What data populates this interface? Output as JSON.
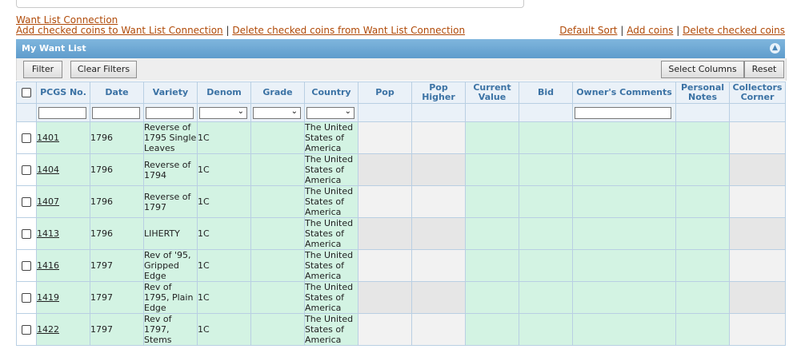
{
  "links": {
    "want_list_connection": "Want List Connection",
    "add_checked": "Add checked coins to Want List Connection",
    "delete_checked": "Delete checked coins from Want List Connection",
    "default_sort": "Default Sort",
    "add_coins": "Add coins",
    "delete_checked_coins": "Delete checked coins",
    "separator": "|"
  },
  "panel": {
    "title": "My Want List"
  },
  "toolbar": {
    "filter": "Filter",
    "clear_filters": "Clear Filters",
    "select_columns": "Select Columns",
    "reset": "Reset"
  },
  "columns": {
    "pcgs_no": "PCGS No.",
    "date": "Date",
    "variety": "Variety",
    "denom": "Denom",
    "grade": "Grade",
    "country": "Country",
    "pop": "Pop",
    "pop_higher": "Pop Higher",
    "current_value": "Current Value",
    "bid": "Bid",
    "owners_comments": "Owner's Comments",
    "personal_notes": "Personal Notes",
    "collectors_corner": "Collectors Corner"
  },
  "rows": [
    {
      "pcgs": "1401",
      "date": "1796",
      "variety": "Reverse of 1795 Single Leaves",
      "denom": "1C",
      "country": "The United States of America"
    },
    {
      "pcgs": "1404",
      "date": "1796",
      "variety": "Reverse of 1794",
      "denom": "1C",
      "country": "The United States of America"
    },
    {
      "pcgs": "1407",
      "date": "1796",
      "variety": "Reverse of 1797",
      "denom": "1C",
      "country": "The United States of America"
    },
    {
      "pcgs": "1413",
      "date": "1796",
      "variety": "LIHERTY",
      "denom": "1C",
      "country": "The United States of America"
    },
    {
      "pcgs": "1416",
      "date": "1797",
      "variety": "Rev of '95, Gripped Edge",
      "denom": "1C",
      "country": "The United States of America"
    },
    {
      "pcgs": "1419",
      "date": "1797",
      "variety": "Rev of 1795, Plain Edge",
      "denom": "1C",
      "country": "The United States of America"
    },
    {
      "pcgs": "1422",
      "date": "1797",
      "variety": "Rev of 1797, Stems",
      "denom": "1C",
      "country": "The United States of America"
    }
  ]
}
